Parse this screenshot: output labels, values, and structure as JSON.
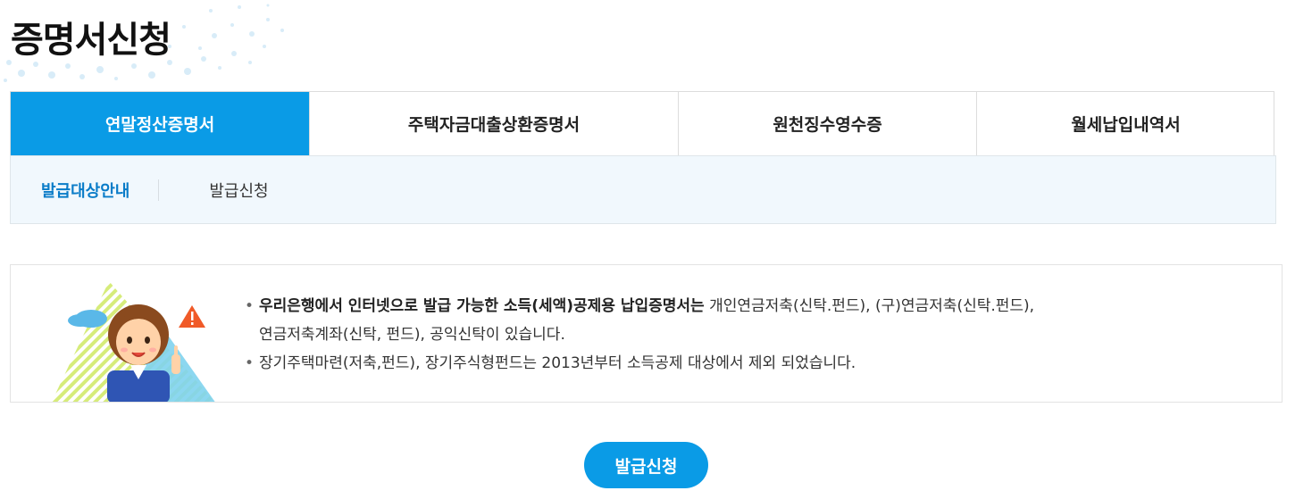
{
  "page": {
    "title": "증명서신청"
  },
  "main_tabs": [
    {
      "label": "연말정산증명서",
      "active": true
    },
    {
      "label": "주택자금대출상환증명서",
      "active": false
    },
    {
      "label": "원천징수영수증",
      "active": false
    },
    {
      "label": "월세납입내역서",
      "active": false
    }
  ],
  "sub_tabs": [
    {
      "label": "발급대상안내",
      "active": true
    },
    {
      "label": "발급신청",
      "active": false
    }
  ],
  "info": {
    "item1_bold": "우리은행에서 인터넷으로 발급 가능한 소득(세액)공제용 납입증명서는",
    "item1_rest": " 개인연금저축(신탁.펀드), (구)연금저축(신탁.펀드),",
    "item1_line2": "연금저축계좌(신탁, 펀드), 공익신탁이 있습니다.",
    "item2": "장기주택마련(저축,펀드), 장기주식형펀드는 2013년부터 소득공제 대상에서 제외 되었습니다.",
    "bullet": "•"
  },
  "actions": {
    "issue_button_label": "발급신청"
  },
  "colors": {
    "accent": "#0a9be6",
    "sub_tab_active": "#0a7cc8",
    "sub_tab_bg": "#f1f8fd"
  }
}
